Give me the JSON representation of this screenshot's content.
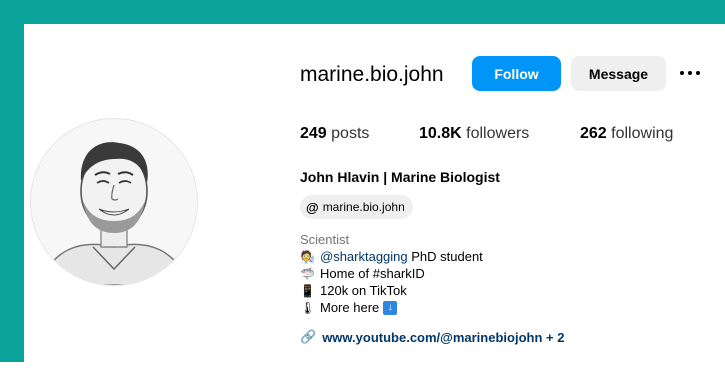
{
  "profile": {
    "username": "marine.bio.john",
    "follow_label": "Follow",
    "message_label": "Message",
    "stats": {
      "posts_count": "249",
      "posts_label": "posts",
      "followers_count": "10.8K",
      "followers_label": "followers",
      "following_count": "262",
      "following_label": "following"
    },
    "full_name": "John Hlavin | Marine Biologist",
    "threads_handle": "marine.bio.john",
    "category": "Scientist",
    "bio": {
      "line1_mention": "@sharktagging",
      "line1_text": " PhD student",
      "line2": "Home of #sharkID",
      "line3": "120k on TikTok",
      "line4": "More here",
      "link": "www.youtube.com/@marinebiojohn + 2"
    }
  },
  "icons": {
    "threads": "threads-icon",
    "scientist_emoji": "scientist-emoji-icon",
    "shark_emoji": "shark-emoji-icon",
    "phone_emoji": "phone-emoji-icon",
    "thermometer_emoji": "red-marker-emoji-icon",
    "down_arrow_emoji": "down-arrow-emoji-icon",
    "link": "link-icon",
    "more": "more-options-icon"
  },
  "colors": {
    "frame": "#0aa39a",
    "follow_button": "#0095f6",
    "message_button": "#efefef",
    "link": "#00376b",
    "muted": "#737373"
  }
}
